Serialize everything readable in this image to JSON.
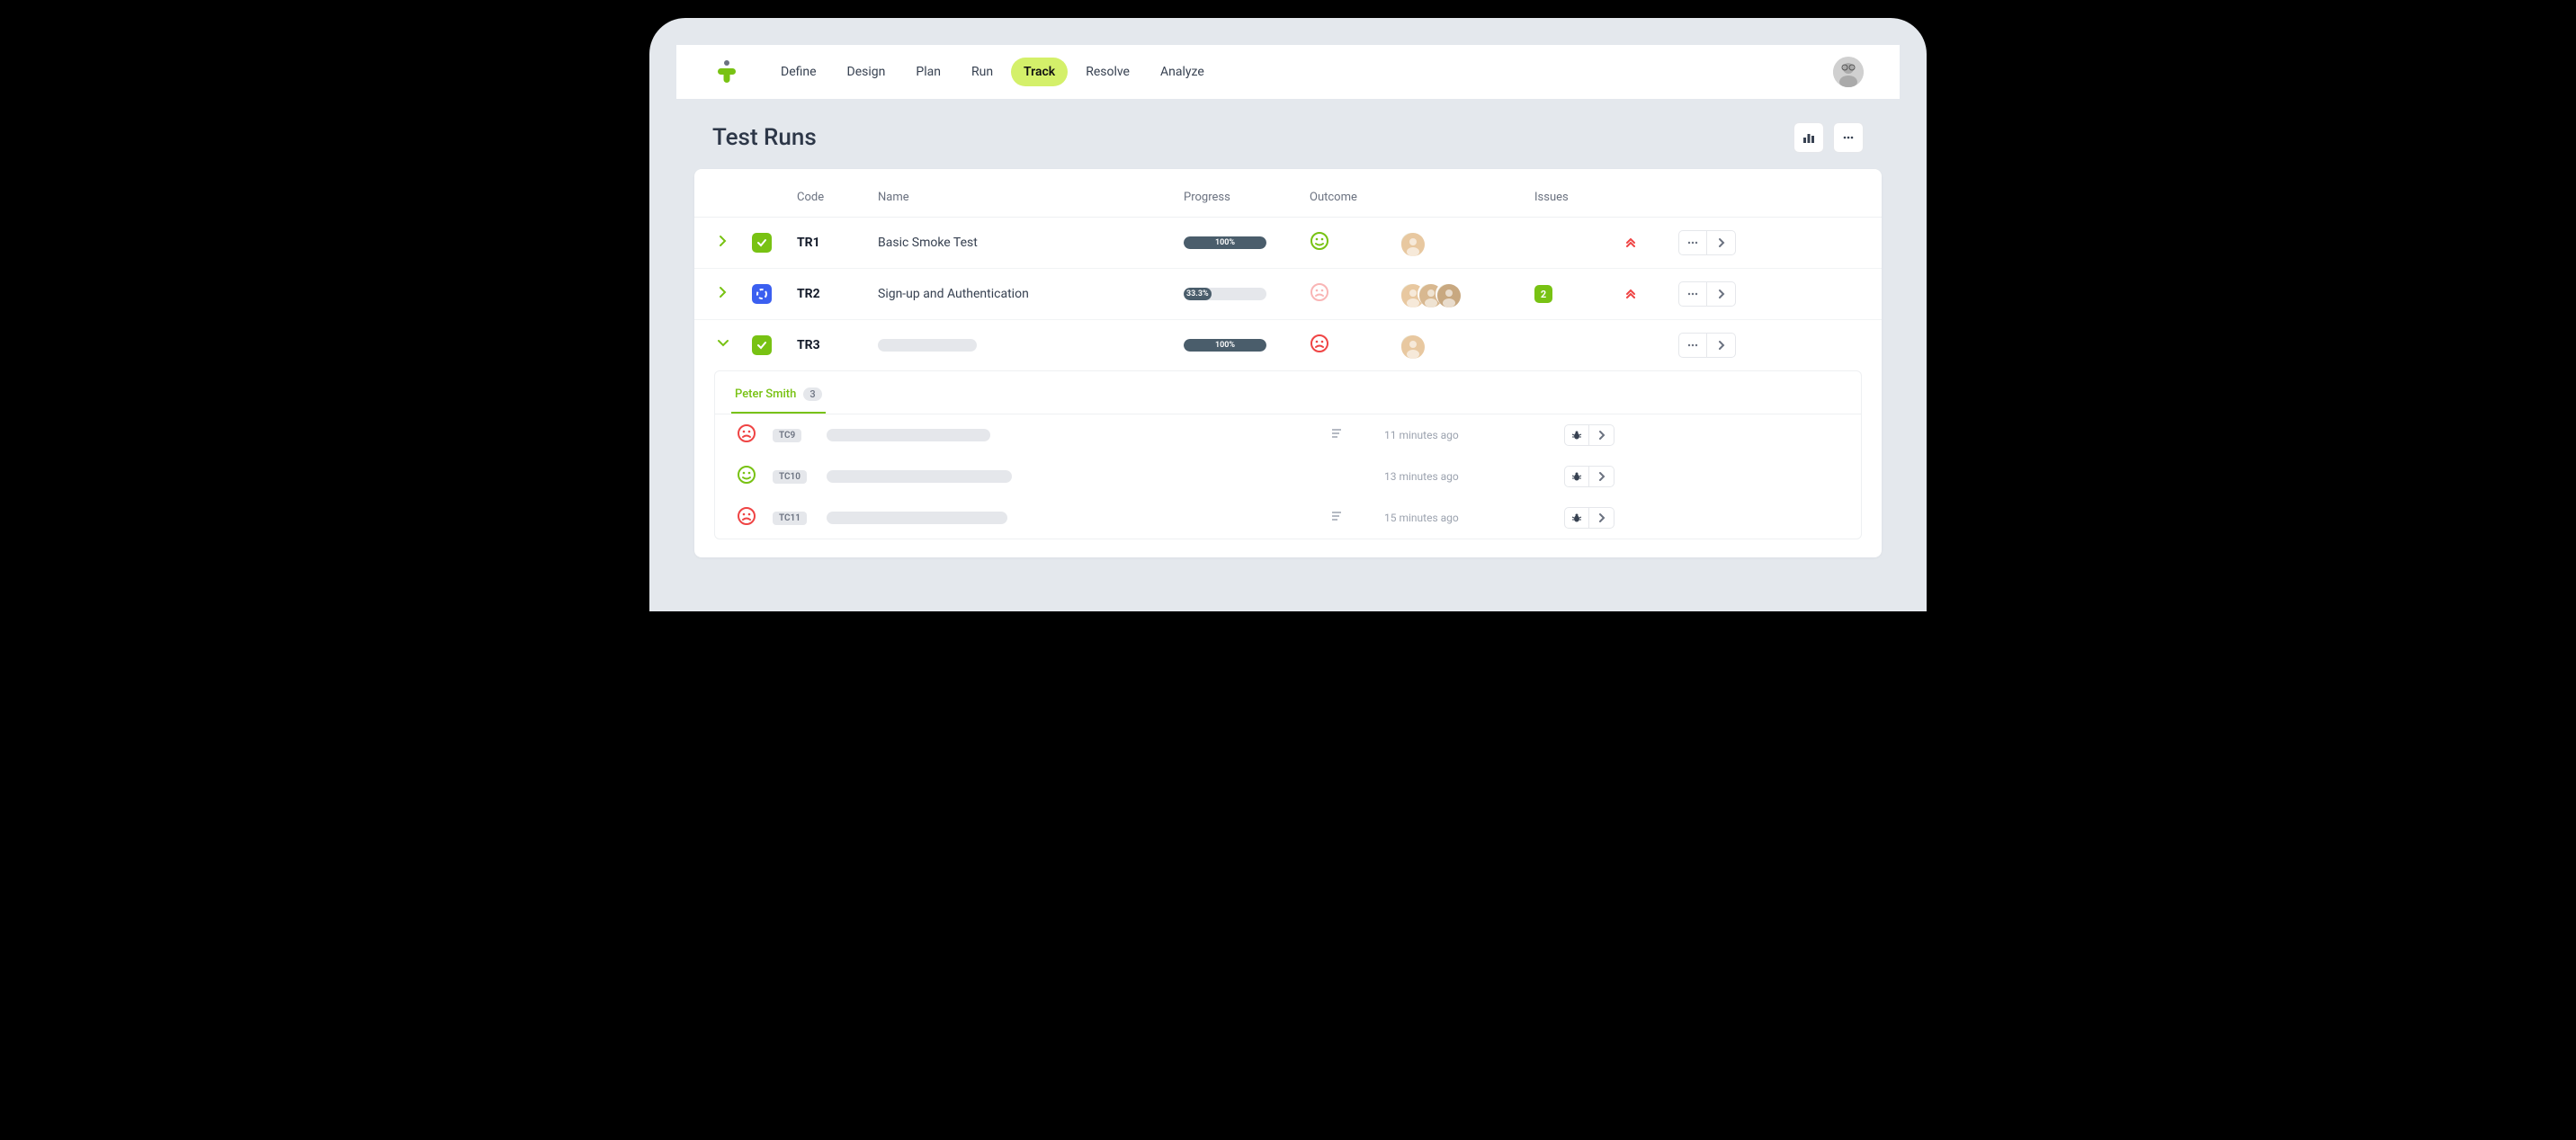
{
  "nav": {
    "items": [
      "Define",
      "Design",
      "Plan",
      "Run",
      "Track",
      "Resolve",
      "Analyze"
    ],
    "active": "Track"
  },
  "page": {
    "title": "Test Runs"
  },
  "columns": {
    "code": "Code",
    "name": "Name",
    "progress": "Progress",
    "outcome": "Outcome",
    "issues": "Issues"
  },
  "runs": [
    {
      "code": "TR1",
      "name": "Basic Smoke Test",
      "status": "done",
      "progress_pct": 100,
      "progress_label": "100%",
      "outcome": "pass",
      "assignees": 1,
      "issues": null,
      "priority": "high",
      "expanded": false
    },
    {
      "code": "TR2",
      "name": "Sign-up and Authentication",
      "status": "in-progress",
      "progress_pct": 33.3,
      "progress_label": "33.3%",
      "outcome": "fail-soft",
      "assignees": 3,
      "issues": 2,
      "priority": "high",
      "expanded": false
    },
    {
      "code": "TR3",
      "name": "",
      "status": "done",
      "progress_pct": 100,
      "progress_label": "100%",
      "outcome": "fail",
      "assignees": 1,
      "issues": null,
      "priority": null,
      "expanded": true
    }
  ],
  "sub_panel": {
    "tab_label": "Peter Smith",
    "tab_count": "3",
    "cases": [
      {
        "outcome": "fail",
        "code": "TC9",
        "has_notes": true,
        "time": "11 minutes ago"
      },
      {
        "outcome": "pass",
        "code": "TC10",
        "has_notes": false,
        "time": "13 minutes ago"
      },
      {
        "outcome": "fail",
        "code": "TC11",
        "has_notes": true,
        "time": "15 minutes ago"
      }
    ]
  },
  "colors": {
    "brand": "#78c213",
    "accent_bg": "#d4f06a",
    "blue": "#3b5ff0",
    "red": "#ef4444",
    "slate": "#4a5d6b"
  }
}
